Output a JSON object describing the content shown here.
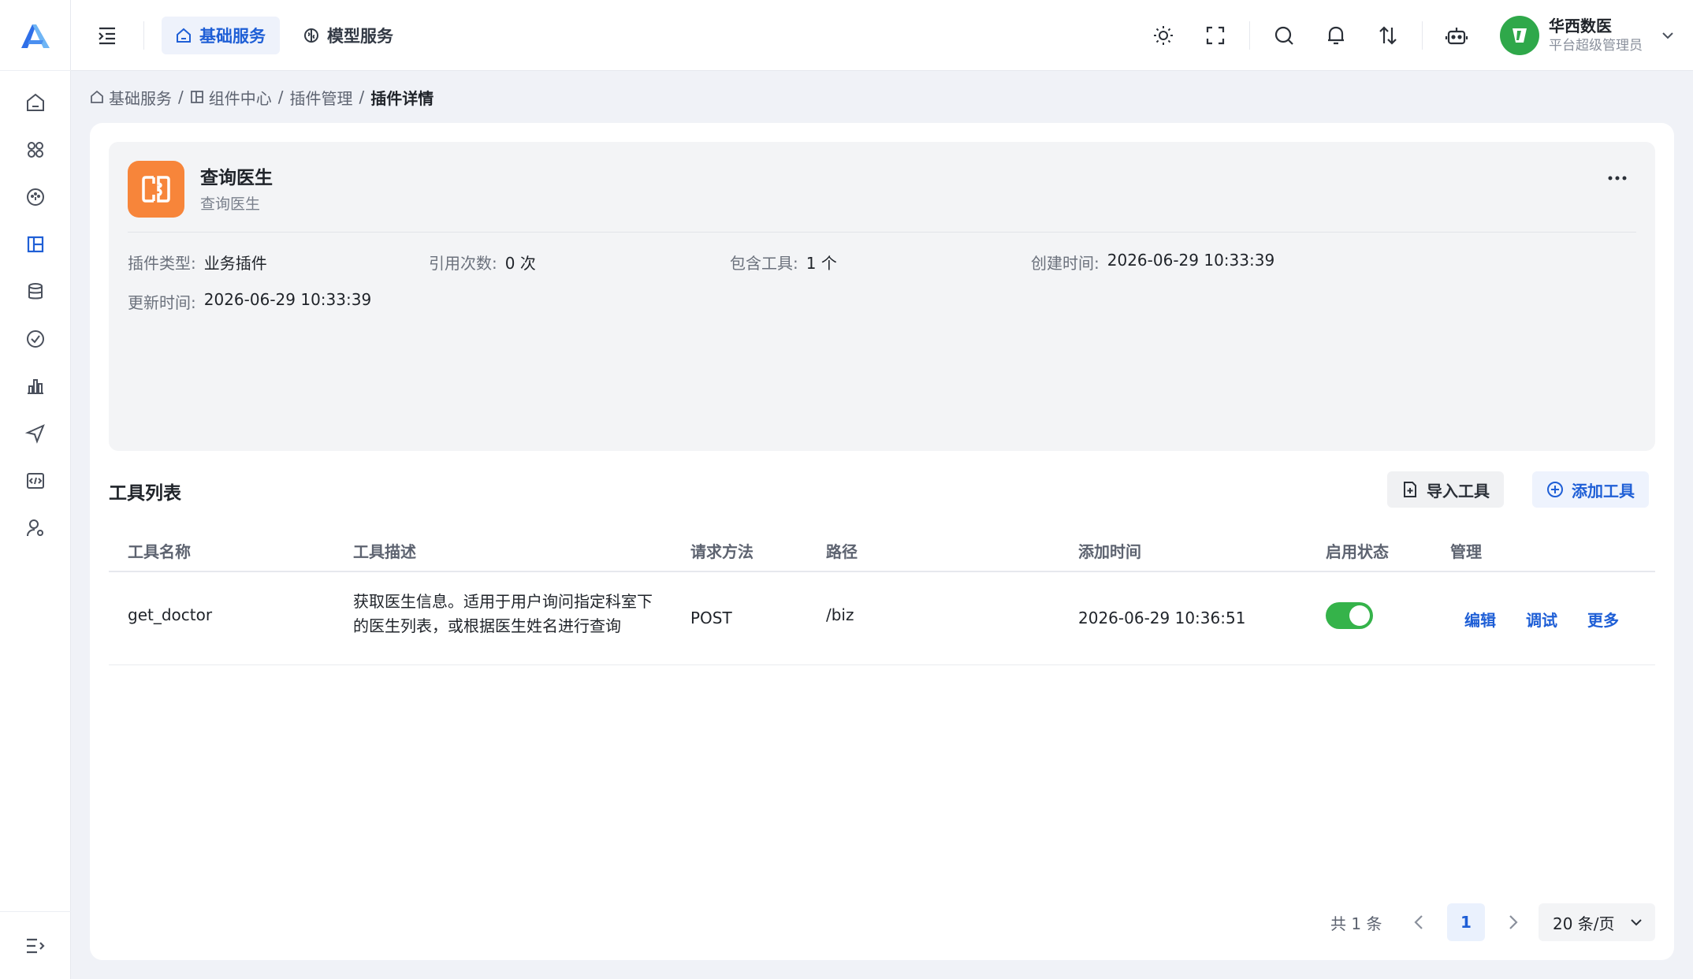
{
  "header": {
    "tabs": [
      {
        "label": "基础服务",
        "icon": "home-icon",
        "active": true
      },
      {
        "label": "模型服务",
        "icon": "brain-icon",
        "active": false
      }
    ],
    "user": {
      "name": "华西数医",
      "role": "平台超级管理员"
    }
  },
  "breadcrumb": {
    "items": [
      "基础服务",
      "组件中心",
      "插件管理"
    ],
    "current": "插件详情",
    "separator": "/"
  },
  "plugin": {
    "name": "查询医生",
    "description": "查询医生",
    "meta": {
      "type_label": "插件类型:",
      "type_value": "业务插件",
      "refs_label": "引用次数:",
      "refs_value": "0 次",
      "tools_label": "包含工具:",
      "tools_value": "1 个",
      "created_label": "创建时间:",
      "created_value": "2026-06-29 10:33:39",
      "updated_label": "更新时间:",
      "updated_value": "2026-06-29 10:33:39"
    }
  },
  "tools": {
    "title": "工具列表",
    "import_label": "导入工具",
    "add_label": "添加工具",
    "columns": [
      "工具名称",
      "工具描述",
      "请求方法",
      "路径",
      "添加时间",
      "启用状态",
      "管理"
    ],
    "rows": [
      {
        "name": "get_doctor",
        "description": "获取医生信息。适用于用户询问指定科室下的医生列表，或根据医生姓名进行查询",
        "method": "POST",
        "path": "/biz",
        "added": "2026-06-29 10:36:51",
        "enabled": true,
        "actions": [
          "编辑",
          "调试",
          "更多"
        ]
      }
    ]
  },
  "pagination": {
    "total_text": "共 1 条",
    "current_page": "1",
    "page_size": "20 条/页"
  },
  "colors": {
    "accent": "#1f5fd6",
    "plugin_icon_bg": "#f7853a",
    "toggle_on": "#35b34a",
    "avatar_bg": "#2fa84a"
  }
}
